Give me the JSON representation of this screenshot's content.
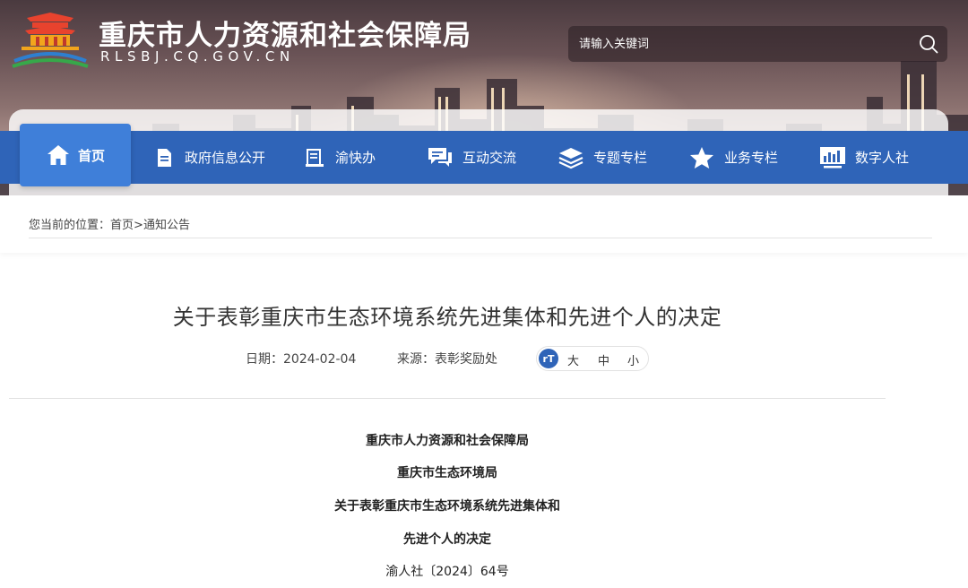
{
  "header": {
    "site_title": "重庆市人力资源和社会保障局",
    "site_domain": "RLSBJ.CQ.GOV.CN",
    "logo_icon": "temple-logo-icon",
    "search": {
      "placeholder": "请输入关键词",
      "icon": "search-icon"
    }
  },
  "nav": {
    "items": [
      {
        "label": "首页",
        "icon": "home-icon",
        "active": true
      },
      {
        "label": "政府信息公开",
        "icon": "document-icon"
      },
      {
        "label": "渝快办",
        "icon": "notepad-icon"
      },
      {
        "label": "互动交流",
        "icon": "chat-icon"
      },
      {
        "label": "专题专栏",
        "icon": "layers-icon"
      },
      {
        "label": "业务专栏",
        "icon": "star-icon"
      },
      {
        "label": "数字人社",
        "icon": "monitor-chart-icon"
      }
    ],
    "bg_color": "#2f64b8",
    "active_color": "#3f7fd9"
  },
  "breadcrumb": {
    "prefix": "您当前的位置：",
    "home": "首页",
    "separator": ">",
    "current": "通知公告"
  },
  "article": {
    "title": "关于表彰重庆市生态环境系统先进集体和先进个人的决定",
    "date": "日期：2024-02-04",
    "source": "来源：表彰奖励处",
    "font_size": {
      "icon": "rT",
      "large": "大",
      "medium": "中",
      "small": "小"
    },
    "body": [
      "重庆市人力资源和社会保障局",
      "重庆市生态环境局",
      "关于表彰重庆市生态环境系统先进集体和",
      "先进个人的决定",
      "渝人社〔2024〕64号"
    ]
  }
}
